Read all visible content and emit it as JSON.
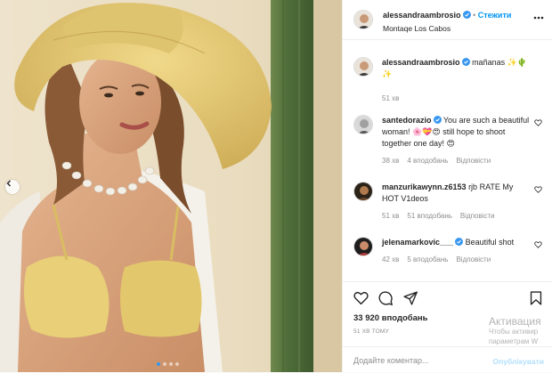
{
  "header": {
    "username": "alessandraambrosio",
    "separator": "•",
    "follow_label": "Стежити",
    "location": "Montaqe Los Cabos"
  },
  "caption": {
    "username": "alessandraambrosio",
    "text": "mañanas ✨🌵✨",
    "time": "51 хв"
  },
  "comments": [
    {
      "username": "santedorazio",
      "verified": true,
      "text": "You are such a beautiful woman! 🌸💝😍 still hope to shoot together one day! 😍",
      "time": "38 хв",
      "likes": "4 вподобань",
      "reply": "Відповісти"
    },
    {
      "username": "manzurikawynn.z6153",
      "verified": false,
      "text": "rjb RATE My HOT V1deos",
      "time": "51 хв",
      "likes": "51 вподобань",
      "reply": "Відповісти"
    },
    {
      "username": "jelenamarkovic___",
      "verified": true,
      "text": "Beautiful shot",
      "time": "42 хв",
      "likes": "5 вподобань",
      "reply": "Відповісти"
    }
  ],
  "stats": {
    "likes": "33 920 вподобань",
    "time": "51 ХВ ТОМУ"
  },
  "add_comment": {
    "placeholder": "Додайте коментар...",
    "publish_label": "Опублікувати"
  },
  "watermark": {
    "line1": "Активация",
    "line2": "Чтобы активир",
    "line3": "параметрам W"
  },
  "carousel": {
    "count": 4,
    "active": 1
  },
  "colors": {
    "accent": "#0095f6",
    "hat": "#e6c873",
    "bikini": "#e8cf78",
    "cactus": "#5d7a45"
  },
  "icons": [
    "verified-badge-icon",
    "more-options-icon",
    "heart-icon",
    "comment-icon",
    "share-icon",
    "bookmark-icon",
    "chevron-left-icon"
  ]
}
